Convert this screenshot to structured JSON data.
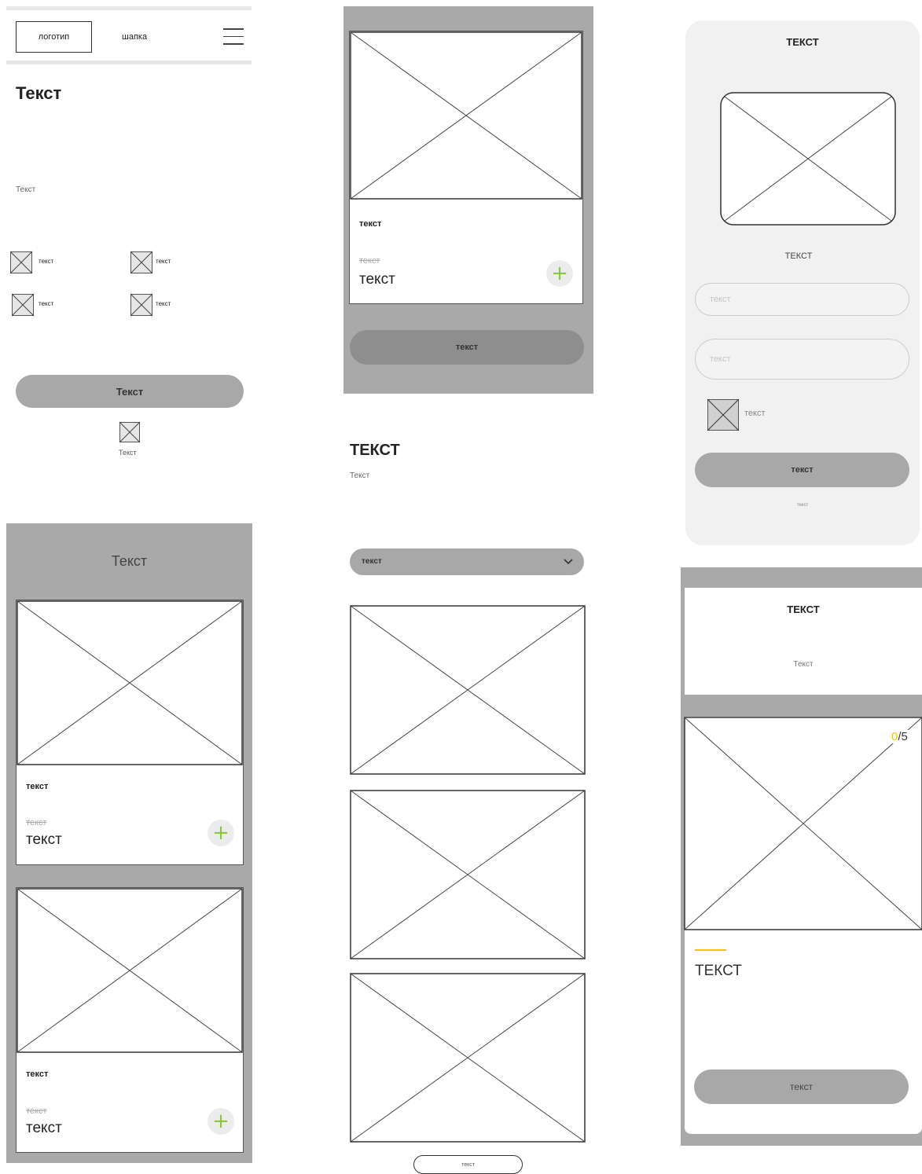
{
  "screen1": {
    "logo": "логотип",
    "header": "шапка",
    "title": "Текст",
    "subtitle": "Текст",
    "features": [
      "текст",
      "текст",
      "текст",
      "текст"
    ],
    "button": "Текст",
    "bottom_caption": "Текст"
  },
  "screen2": {
    "card": {
      "title": "текст",
      "old_price": "текст",
      "price": "текст"
    },
    "button": "текст",
    "plus_symbol": "+"
  },
  "screen3": {
    "title": "ТЕКСТ",
    "image_caption": "ТЕКСТ",
    "input1_placeholder": "текст",
    "input2_placeholder": "текст",
    "checkbox_label": "текст",
    "button": "текст",
    "footer_link": "текст"
  },
  "screen4": {
    "header": "Текст",
    "cards": [
      {
        "title": "текст",
        "old_price": "текст",
        "price": "текст"
      },
      {
        "title": "текст",
        "old_price": "текст",
        "price": "текст"
      }
    ]
  },
  "screen5": {
    "title": "ТЕКСТ",
    "subtitle": "Текст",
    "dropdown_value": "текст",
    "more_button": "текст"
  },
  "screen6": {
    "title": "ТЕКСТ",
    "subtitle": "Текст",
    "counter_current": "0",
    "counter_total": "/5",
    "heading": "ТЕКСТ",
    "button": "текст"
  },
  "colors": {
    "accent_green": "#8cc63f",
    "accent_yellow": "#f5c400",
    "gray": "#a8a8a8"
  }
}
